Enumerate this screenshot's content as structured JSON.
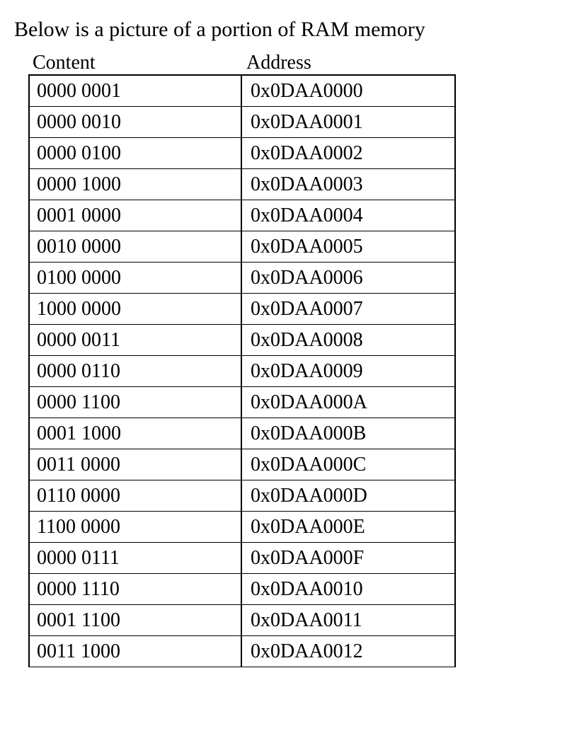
{
  "title": "Below is a picture of a portion of RAM memory",
  "headers": {
    "content": "Content",
    "address": "Address"
  },
  "rows": [
    {
      "content": "0000 0001",
      "address": "0x0DAA0000"
    },
    {
      "content": "0000 0010",
      "address": "0x0DAA0001"
    },
    {
      "content": "0000 0100",
      "address": "0x0DAA0002"
    },
    {
      "content": "0000 1000",
      "address": "0x0DAA0003"
    },
    {
      "content": "0001 0000",
      "address": "0x0DAA0004"
    },
    {
      "content": "0010 0000",
      "address": "0x0DAA0005"
    },
    {
      "content": "0100 0000",
      "address": "0x0DAA0006"
    },
    {
      "content": "1000 0000",
      "address": "0x0DAA0007"
    },
    {
      "content": "0000 0011",
      "address": "0x0DAA0008"
    },
    {
      "content": "0000 0110",
      "address": "0x0DAA0009"
    },
    {
      "content": "0000 1100",
      "address": "0x0DAA000A"
    },
    {
      "content": "0001 1000",
      "address": "0x0DAA000B"
    },
    {
      "content": "0011 0000",
      "address": "0x0DAA000C"
    },
    {
      "content": "0110 0000",
      "address": "0x0DAA000D"
    },
    {
      "content": "1100 0000",
      "address": "0x0DAA000E"
    },
    {
      "content": "0000 0111",
      "address": "0x0DAA000F"
    },
    {
      "content": "0000 1110",
      "address": "0x0DAA0010"
    },
    {
      "content": "0001 1100",
      "address": "0x0DAA0011"
    },
    {
      "content": "0011 1000",
      "address": "0x0DAA0012"
    }
  ]
}
